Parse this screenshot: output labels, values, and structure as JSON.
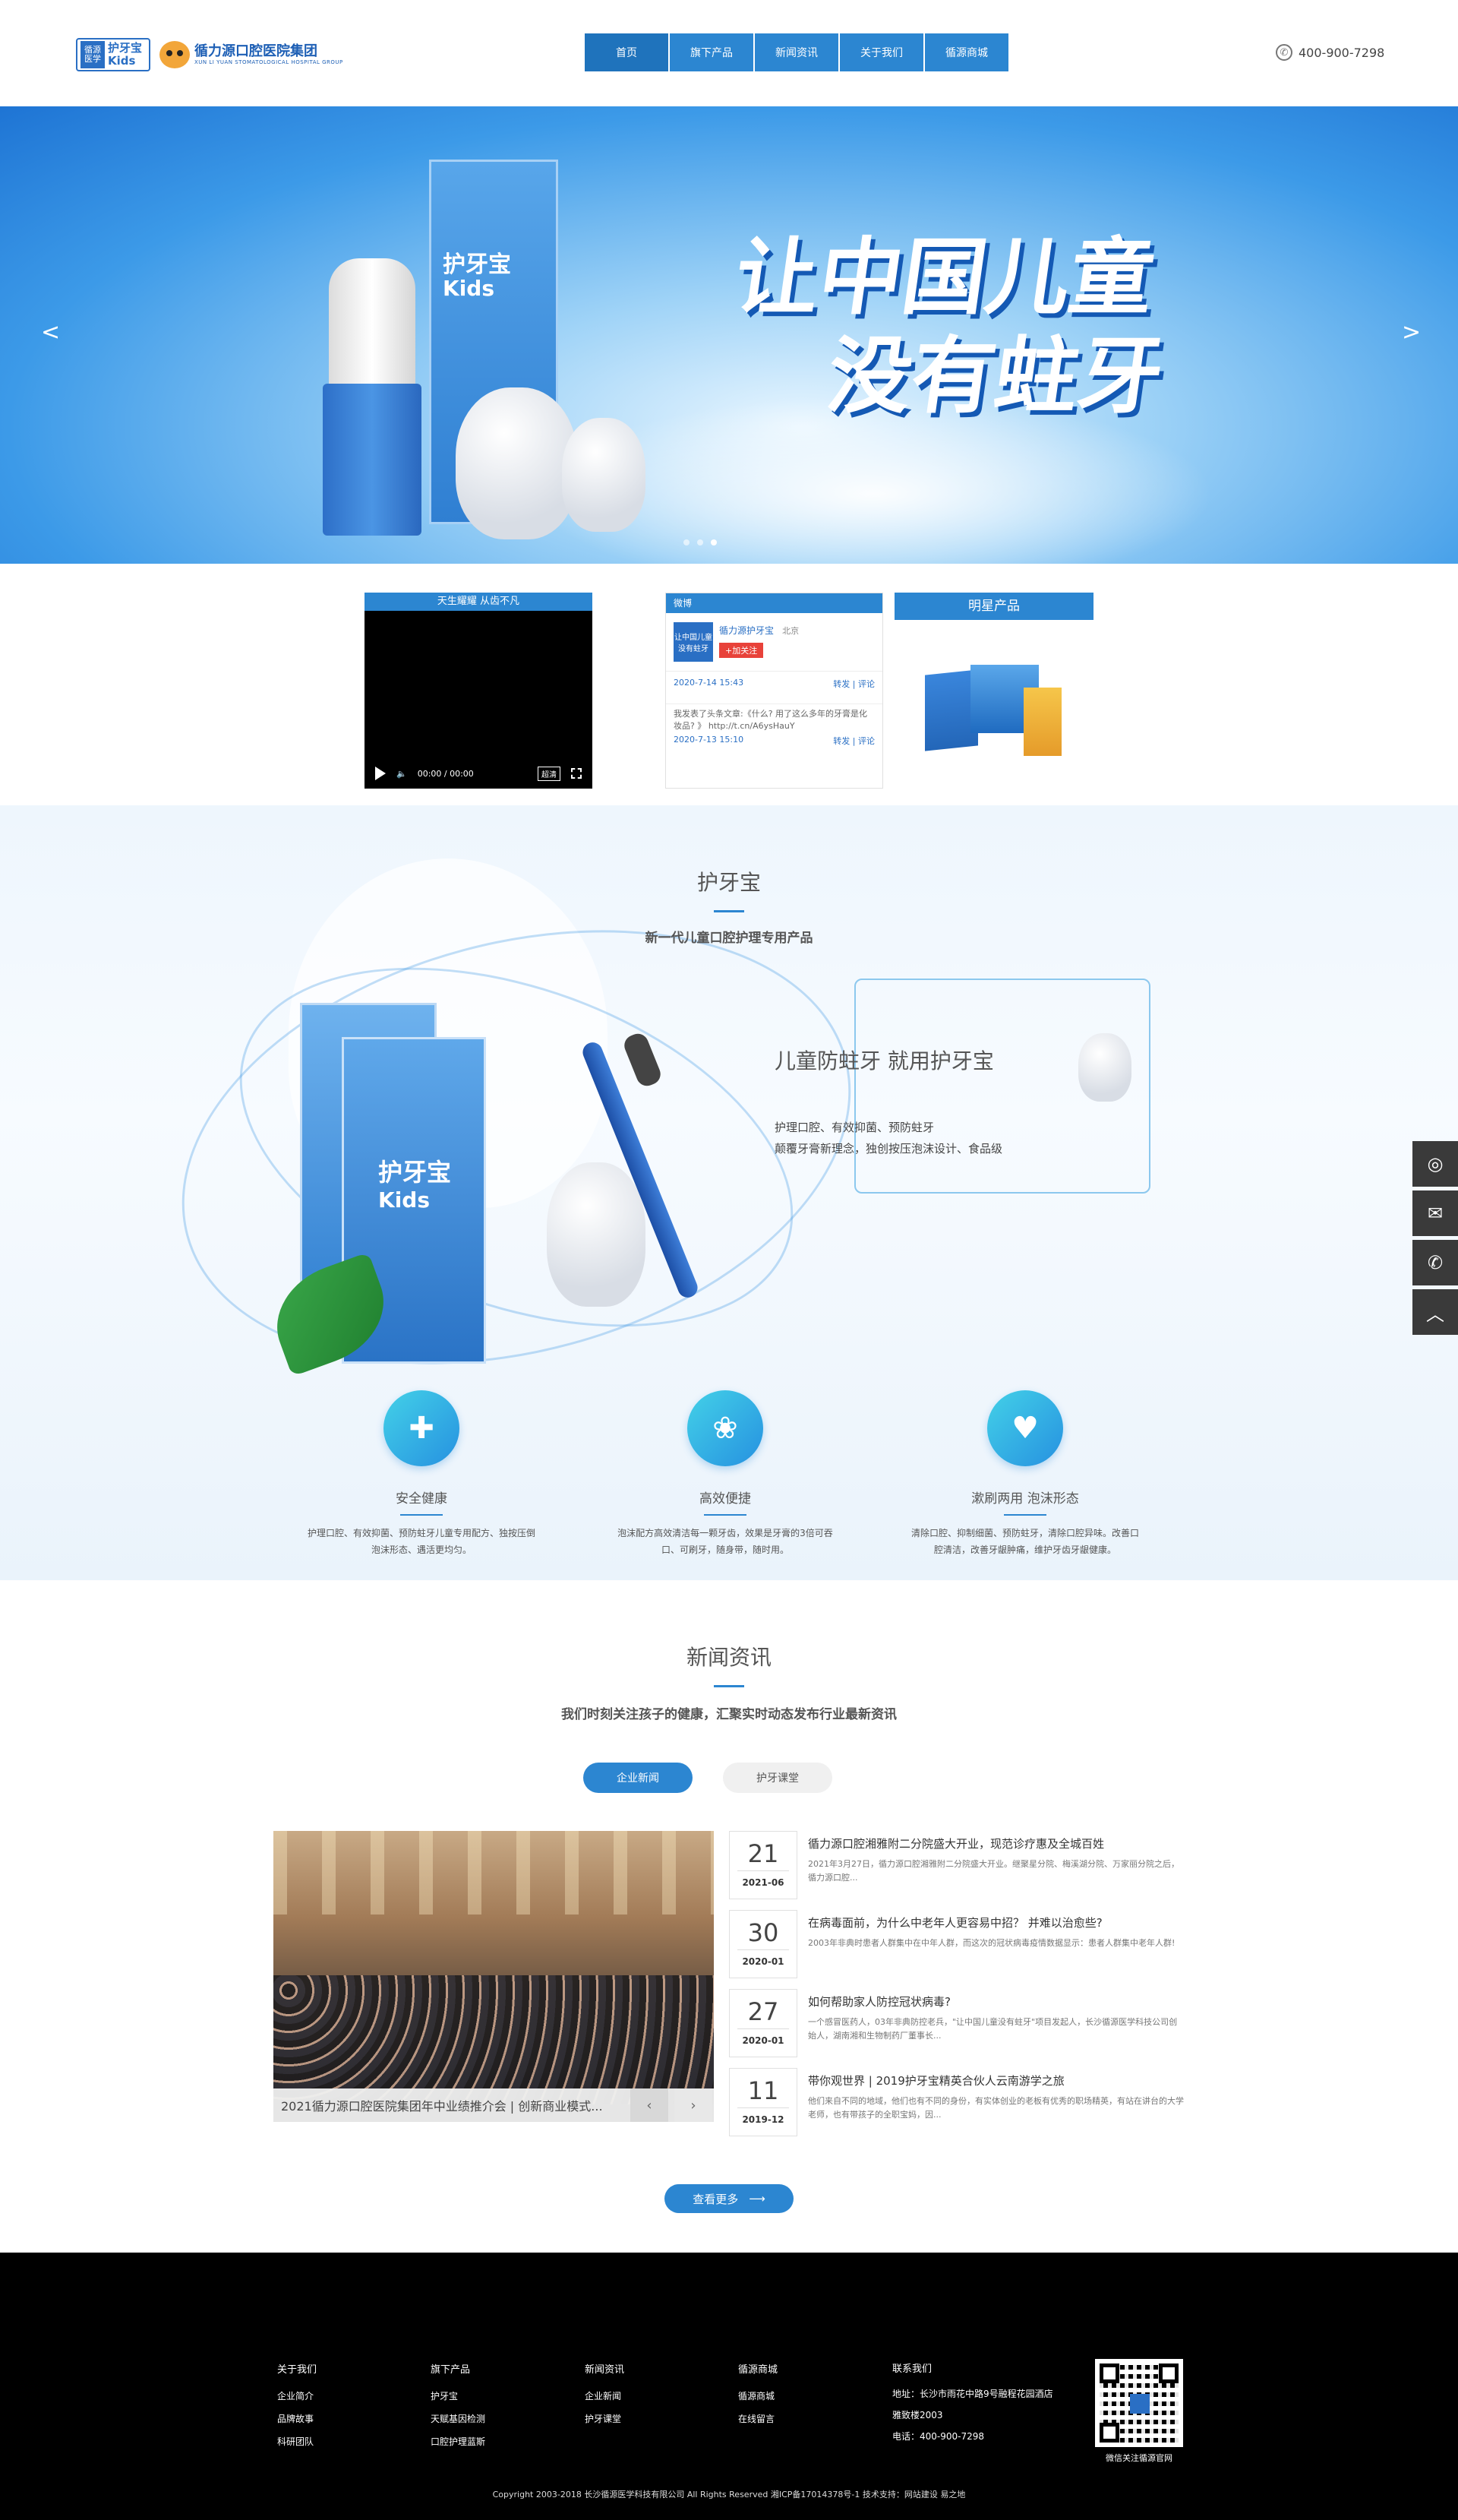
{
  "header": {
    "logo_badge_text": "护牙宝",
    "logo_badge_small": "循源医学",
    "logo_kids": "Kids",
    "logo_group_name": "循力源口腔医院集团",
    "logo_group_sub": "XUN LI YUAN STOMATOLOGICAL HOSPITAL GROUP",
    "nav": [
      {
        "label": "首页",
        "active": true
      },
      {
        "label": "旗下产品"
      },
      {
        "label": "新闻资讯"
      },
      {
        "label": "关于我们"
      },
      {
        "label": "循源商城"
      }
    ],
    "phone": "400-900-7298"
  },
  "banner": {
    "headline_line1": "让中国儿童",
    "headline_line2": "没有蛀牙",
    "box_title": "护牙宝",
    "box_sub": "Kids",
    "prev": "<",
    "next": ">"
  },
  "strip": {
    "video_title": "天生耀耀 从齿不凡",
    "video_time": "00:00 / 00:00",
    "video_hd": "超清",
    "weibo_tab": "微博",
    "weibo_name": "循力源护牙宝",
    "weibo_loc": "北京",
    "weibo_follow": "+加关注",
    "weibo_avatar": "让中国儿童没有蛀牙",
    "weibo_posts": [
      {
        "text": "",
        "date": "2020-7-14 15:43",
        "actions": "转发 | 评论"
      },
      {
        "text": "我发表了头条文章:《什么? 用了这么多年的牙膏是化妆品? 》 http://t.cn/A6ysHauY",
        "date": "2020-7-13 15:10",
        "actions": "转发 | 评论"
      }
    ],
    "star_title": "明星产品"
  },
  "intro": {
    "title": "护牙宝",
    "subtitle": "新一代儿童口腔护理专用产品",
    "box_title": "护牙宝",
    "box_sub": "Kids",
    "callout_title": "儿童防蛀牙 就用护牙宝",
    "callout_line1": "护理口腔、有效抑菌、预防蛀牙",
    "callout_line2": "颠覆牙膏新理念，独创按压泡沫设计、食品级",
    "features": [
      {
        "icon": "shield-plus-icon",
        "title": "安全健康",
        "desc": "护理口腔、有效抑菌、预防蛀牙儿童专用配方、独按压倒泡沫形态、遇活更均匀。"
      },
      {
        "icon": "tulip-icon",
        "title": "高效便捷",
        "desc": "泡沫配方高效清洁每一颗牙齿，效果是牙膏的3倍可吞口、可刷牙，随身带，随时用。"
      },
      {
        "icon": "heartbeat-icon",
        "title": "漱刷两用 泡沫形态",
        "desc": "清除口腔、抑制细菌、预防蛀牙，清除口腔异味。改善口腔清洁，改善牙龈肿痛，维护牙齿牙龈健康。"
      }
    ]
  },
  "news": {
    "title": "新闻资讯",
    "subtitle": "我们时刻关注孩子的健康，汇聚实时动态发布行业最新资讯",
    "tabs": [
      {
        "label": "企业新闻",
        "active": true
      },
      {
        "label": "护牙课堂"
      }
    ],
    "photo_caption": "2021循力源口腔医院集团年中业绩推介会 | 创新商业模式...",
    "items": [
      {
        "day": "21",
        "ym": "2021-06",
        "title": "循力源口腔湘雅附二分院盛大开业，现范诊疗惠及全城百姓",
        "summary": "2021年3月27日，循力源口腔湘雅附二分院盛大开业。继聚星分院、梅溪湖分院、万家丽分院之后，循力源口腔..."
      },
      {
        "day": "30",
        "ym": "2020-01",
        "title": "在病毒面前，为什么中老年人更容易中招？ 并难以治愈些?",
        "summary": "2003年非典时患者人群集中在中年人群，而这次的冠状病毒疫情数据显示：患者人群集中老年人群!"
      },
      {
        "day": "27",
        "ym": "2020-01",
        "title": "如何帮助家人防控冠状病毒?",
        "summary": "一个感冒医药人，03年非典防控老兵，\"让中国儿童没有蛀牙\"项目发起人，长沙循源医学科技公司创始人，湖南湘和生物制药厂董事长..."
      },
      {
        "day": "11",
        "ym": "2019-12",
        "title": "带你观世界 | 2019护牙宝精英合伙人云南游学之旅",
        "summary": "他们来自不同的地域，他们也有不同的身份，有实体创业的老板有优秀的职场精英，有站在讲台的大学老师，也有带孩子的全职宝妈，因..."
      }
    ],
    "more_label": "查看更多",
    "more_arrow": "⟶"
  },
  "footer": {
    "columns": [
      {
        "head": "关于我们",
        "items": [
          "企业简介",
          "品牌故事",
          "科研团队"
        ]
      },
      {
        "head": "旗下产品",
        "items": [
          "护牙宝",
          "天赋基因检测",
          "口腔护理蓝斯"
        ]
      },
      {
        "head": "新闻资讯",
        "items": [
          "企业新闻",
          "护牙课堂"
        ]
      },
      {
        "head": "循源商城",
        "items": [
          "循源商城",
          "在线留言"
        ]
      },
      {
        "head": "联系我们",
        "items": [
          "地址：长沙市雨花中路9号融程花园酒店雅致楼2003",
          "电话：400-900-7298"
        ]
      }
    ],
    "qr_caption": "微信关注循源官网",
    "copyright": "Copyright 2003-2018 长沙循源医学科技有限公司 All Rights Reserved   湘ICP备17014378号-1   技术支持：网站建设 易之地"
  },
  "colors": {
    "primary": "#2c86d1",
    "footer_bg": "#000000",
    "float_bg": "#3a3a3a"
  }
}
